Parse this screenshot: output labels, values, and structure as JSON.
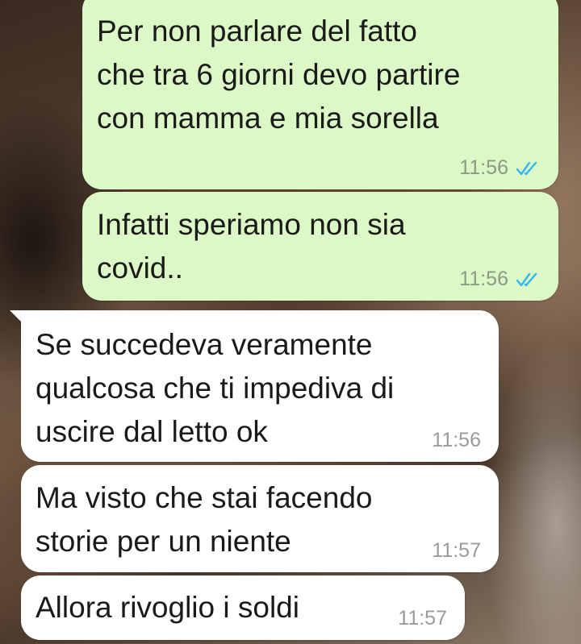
{
  "conversation": {
    "messages": [
      {
        "direction": "outgoing",
        "text": "Per non parlare del fatto\nche tra 6 giorni devo partire\ncon mamma e mia sorella",
        "time": "11:56",
        "status": "read"
      },
      {
        "direction": "outgoing",
        "text": "Infatti speriamo non sia\ncovid..",
        "time": "11:56",
        "status": "read"
      },
      {
        "direction": "incoming",
        "text": "Se succedeva veramente\nqualcosa che ti impediva di\nuscire dal letto ok",
        "time": "11:56"
      },
      {
        "direction": "incoming",
        "text": "Ma visto che stai facendo\nstorie per un niente",
        "time": "11:57"
      },
      {
        "direction": "incoming",
        "text": "Allora rivoglio i soldi",
        "time": "11:57"
      }
    ]
  },
  "colors": {
    "outgoing_bubble": "#dcf8c6",
    "incoming_bubble": "#ffffff",
    "read_ticks": "#34b7f1"
  },
  "icons": {
    "read_status": "double-check-icon"
  }
}
